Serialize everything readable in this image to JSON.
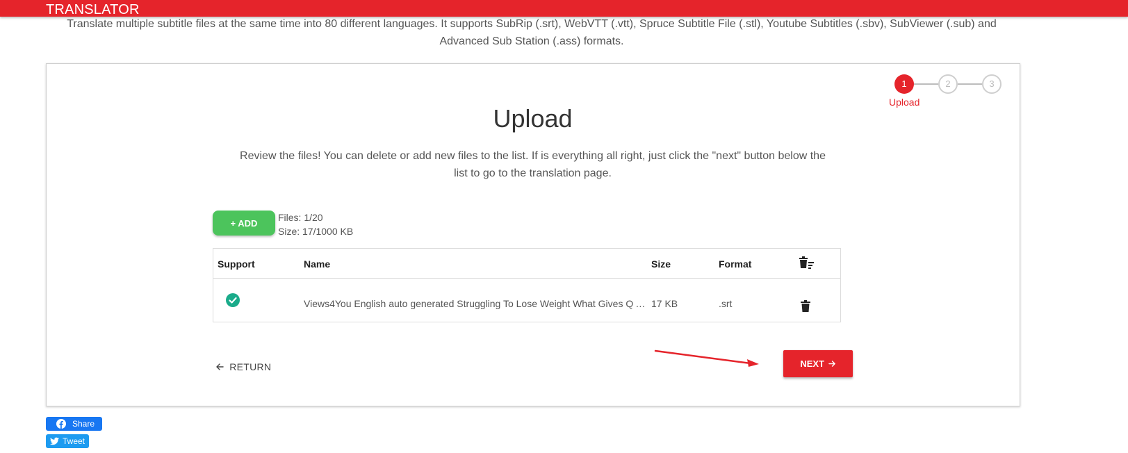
{
  "header": {
    "brand": "TRANSLATOR"
  },
  "intro": "Translate multiple subtitle files at the same time into 80 different languages. It supports SubRip (.srt), WebVTT (.vtt), Spruce Subtitle File (.stl), Youtube Subtitles (.sbv), SubViewer (.sub) and Advanced Sub Station (.ass) formats.",
  "stepper": {
    "steps": [
      {
        "number": "1",
        "label": "Upload"
      },
      {
        "number": "2",
        "label": ""
      },
      {
        "number": "3",
        "label": ""
      }
    ]
  },
  "main": {
    "title": "Upload",
    "description": "Review the files! You can delete or add new files to the list. If is everything all right, just click the \"next\" button below the list to go to the translation page.",
    "add_label": "+ ADD",
    "files_count": "Files: 1/20",
    "size_info": "Size: 17/1000 KB",
    "table": {
      "headers": {
        "support": "Support",
        "name": "Name",
        "size": "Size",
        "format": "Format"
      },
      "rows": [
        {
          "name": "Views4You English auto generated Struggling To Lose Weight What Gives Q A...",
          "size": "17 KB",
          "format": ".srt"
        }
      ]
    },
    "return_label": "RETURN",
    "next_label": "NEXT"
  },
  "social": {
    "share_label": "Share",
    "tweet_label": "Tweet"
  },
  "colors": {
    "accent": "#e5242b",
    "add": "#4cc45c",
    "check": "#1aab8a",
    "facebook": "#1877f2",
    "twitter": "#1d9bf0"
  },
  "icons": [
    "check-circle-icon",
    "trash-icon",
    "trash-list-icon",
    "arrow-left-icon",
    "arrow-right-icon",
    "facebook-icon",
    "twitter-icon"
  ]
}
